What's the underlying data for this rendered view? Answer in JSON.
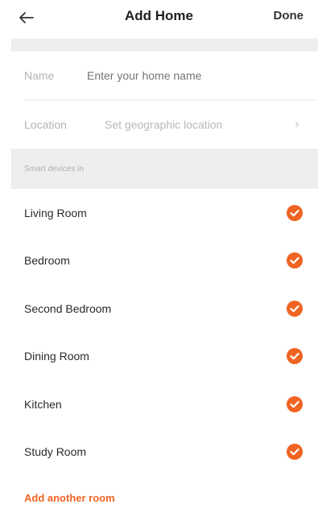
{
  "header": {
    "title": "Add Home",
    "done_label": "Done"
  },
  "form": {
    "name": {
      "label": "Name",
      "placeholder": "Enter your home name"
    },
    "location": {
      "label": "Location",
      "placeholder": "Set geographic location",
      "chevron": "›"
    }
  },
  "section": {
    "label": "Smart devices in"
  },
  "rooms": [
    {
      "name": "Living Room",
      "checked": true
    },
    {
      "name": "Bedroom",
      "checked": true
    },
    {
      "name": "Second Bedroom",
      "checked": true
    },
    {
      "name": "Dining Room",
      "checked": true
    },
    {
      "name": "Kitchen",
      "checked": true
    },
    {
      "name": "Study Room",
      "checked": true
    }
  ],
  "add_room_label": "Add another room",
  "colors": {
    "accent": "#ef6422",
    "section_bg": "#eeeeef"
  },
  "icons": {
    "back": "back-arrow-icon",
    "check": "check-circle-icon",
    "chevron": "chevron-right-icon"
  }
}
